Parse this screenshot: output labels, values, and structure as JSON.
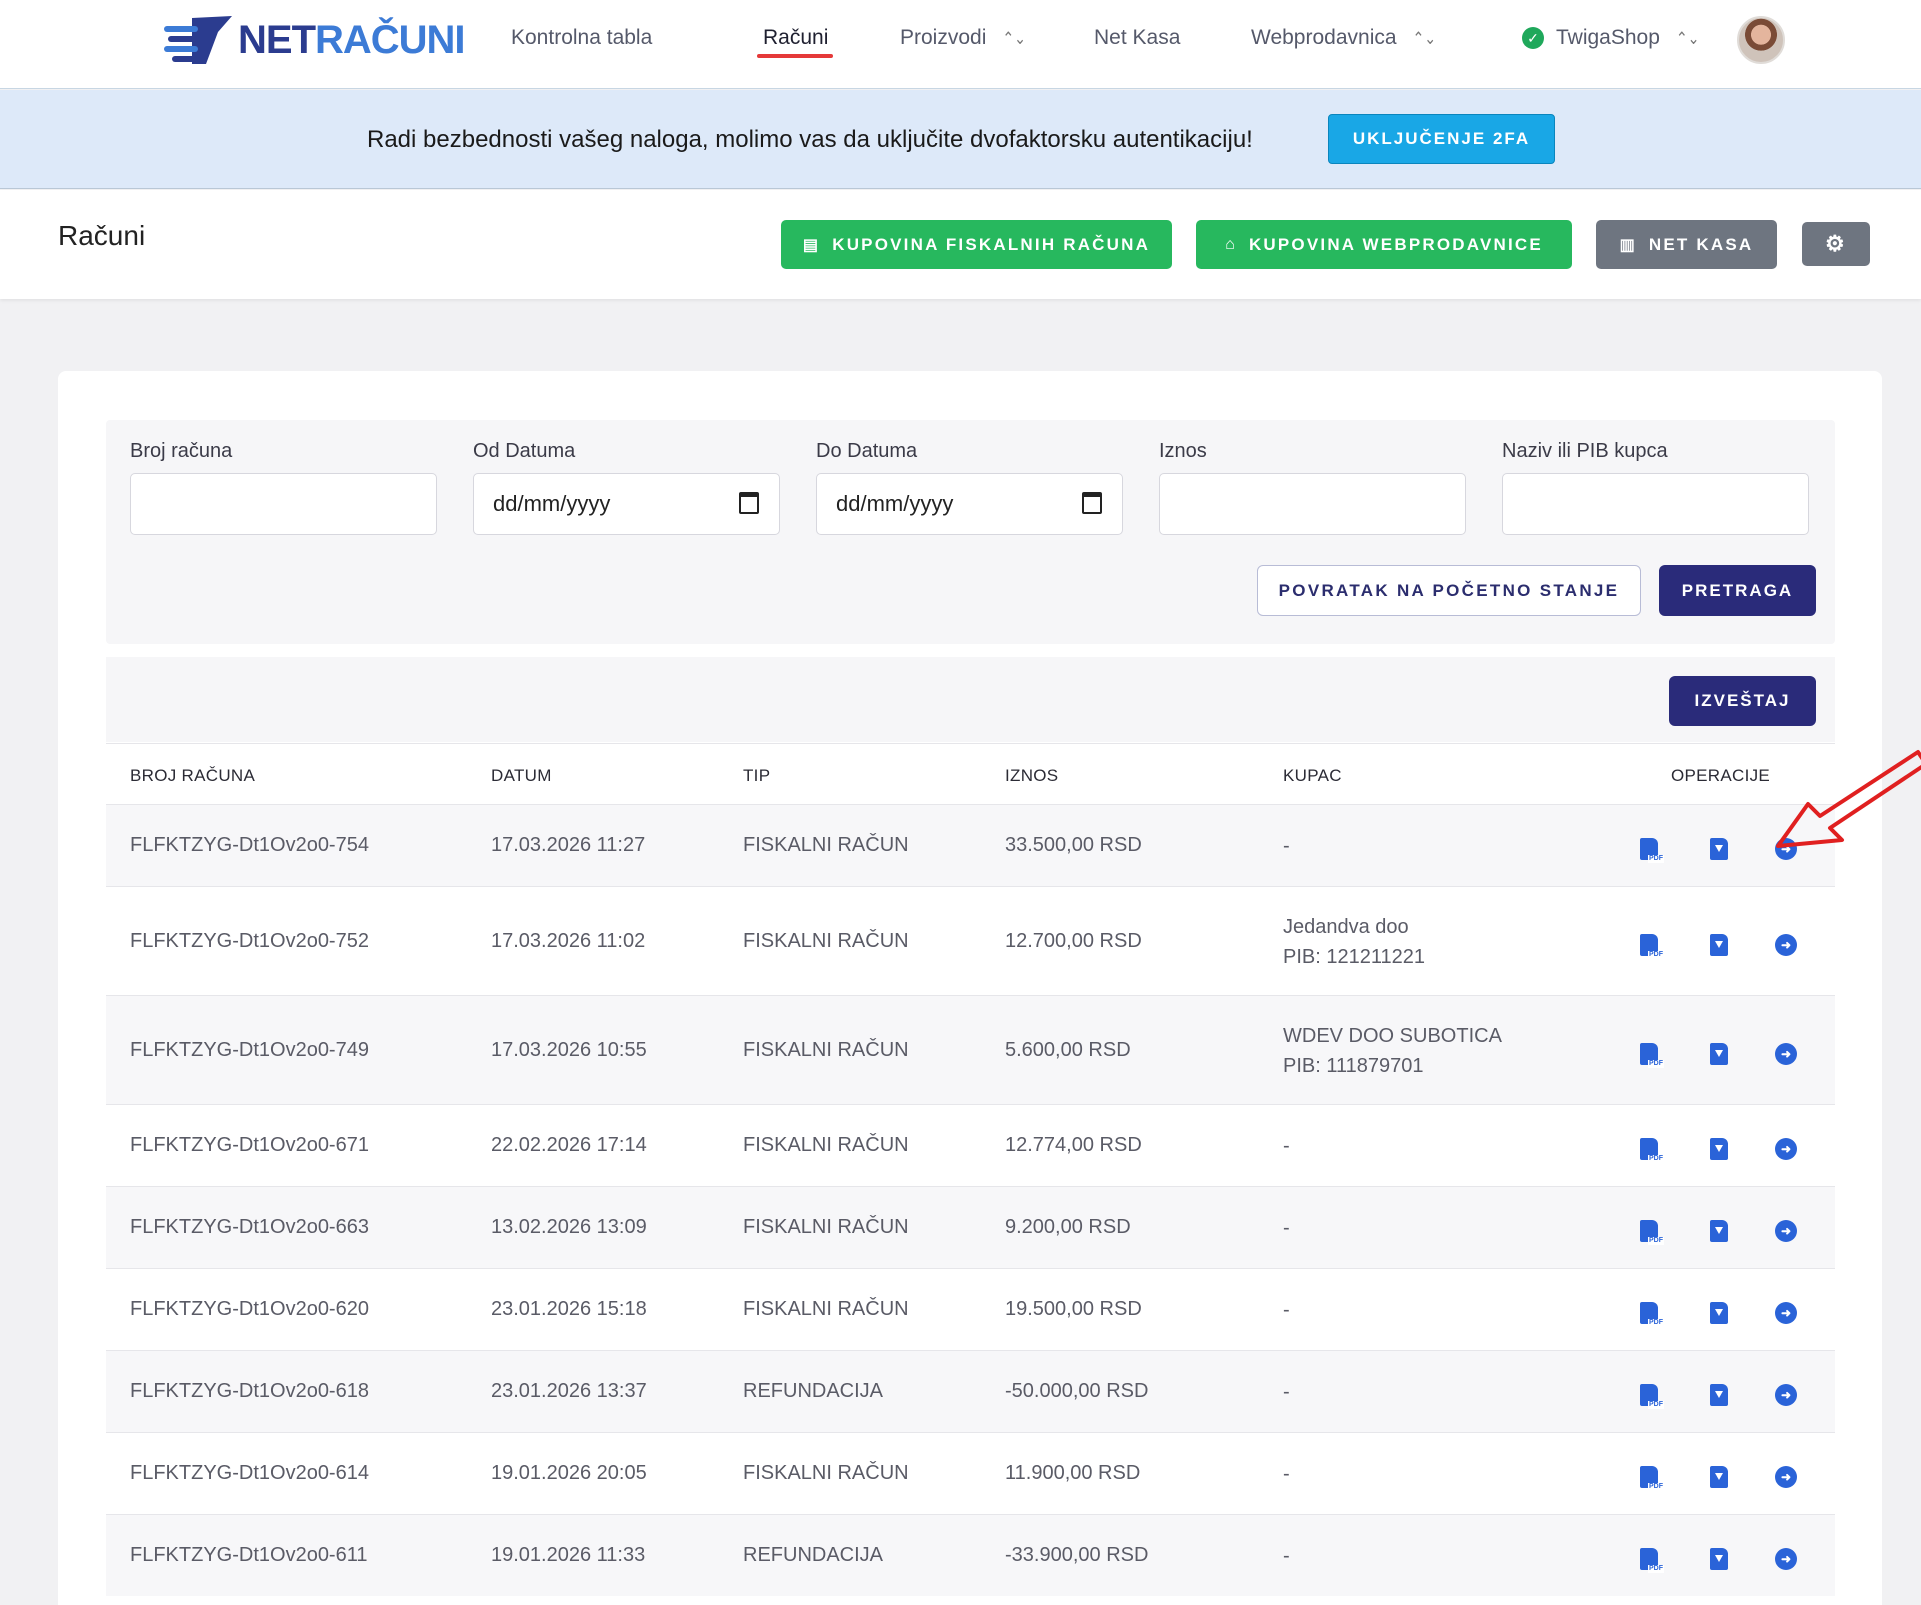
{
  "brand": {
    "name_part1": "NET",
    "name_part2": "RAČUNI"
  },
  "nav": {
    "items": [
      {
        "label": "Kontrolna tabla"
      },
      {
        "label": "Računi"
      },
      {
        "label": "Proizvodi"
      },
      {
        "label": "Net Kasa"
      },
      {
        "label": "Webprodavnica"
      }
    ],
    "shop": {
      "label": "TwigaShop"
    }
  },
  "banner": {
    "text": "Radi bezbednosti vašeg naloga, molimo vas da uključite dvofaktorsku autentikaciju!",
    "button": "UKLJUČENJE 2FA"
  },
  "header": {
    "title": "Računi",
    "buttons": {
      "fiscal": "KUPOVINA FISKALNIH RAČUNA",
      "webshop": "KUPOVINA WEBPRODAVNICE",
      "netkasa": "NET KASA"
    }
  },
  "filters": {
    "invoice_no": {
      "label": "Broj računa",
      "value": ""
    },
    "date_from": {
      "label": "Od Datuma",
      "value": "dd/mm/yyyy"
    },
    "date_to": {
      "label": "Do Datuma",
      "value": "dd/mm/yyyy"
    },
    "amount": {
      "label": "Iznos",
      "value": ""
    },
    "customer": {
      "label": "Naziv ili PIB kupca",
      "value": ""
    },
    "reset_button": "POVRATAK NA POČETNO STANJE",
    "search_button": "PRETRAGA"
  },
  "report_button": "IZVEŠTAJ",
  "table": {
    "columns": [
      "BROJ RAČUNA",
      "DATUM",
      "TIP",
      "IZNOS",
      "KUPAC",
      "OPERACIJE"
    ],
    "rows": [
      {
        "number": "FLFKTZYG-Dt1Ov2o0-754",
        "date": "17.03.2026 11:27",
        "type": "FISKALNI RAČUN",
        "amount": "33.500,00 RSD",
        "customer": "-",
        "pib": ""
      },
      {
        "number": "FLFKTZYG-Dt1Ov2o0-752",
        "date": "17.03.2026 11:02",
        "type": "FISKALNI RAČUN",
        "amount": "12.700,00 RSD",
        "customer": "Jedandva doo",
        "pib": "PIB: 121211221"
      },
      {
        "number": "FLFKTZYG-Dt1Ov2o0-749",
        "date": "17.03.2026 10:55",
        "type": "FISKALNI RAČUN",
        "amount": "5.600,00 RSD",
        "customer": "WDEV DOO SUBOTICA",
        "pib": "PIB: 111879701"
      },
      {
        "number": "FLFKTZYG-Dt1Ov2o0-671",
        "date": "22.02.2026 17:14",
        "type": "FISKALNI RAČUN",
        "amount": "12.774,00 RSD",
        "customer": "-",
        "pib": ""
      },
      {
        "number": "FLFKTZYG-Dt1Ov2o0-663",
        "date": "13.02.2026 13:09",
        "type": "FISKALNI RAČUN",
        "amount": "9.200,00 RSD",
        "customer": "-",
        "pib": ""
      },
      {
        "number": "FLFKTZYG-Dt1Ov2o0-620",
        "date": "23.01.2026 15:18",
        "type": "FISKALNI RAČUN",
        "amount": "19.500,00 RSD",
        "customer": "-",
        "pib": ""
      },
      {
        "number": "FLFKTZYG-Dt1Ov2o0-618",
        "date": "23.01.2026 13:37",
        "type": "REFUNDACIJA",
        "amount": "-50.000,00 RSD",
        "customer": "-",
        "pib": ""
      },
      {
        "number": "FLFKTZYG-Dt1Ov2o0-614",
        "date": "19.01.2026 20:05",
        "type": "FISKALNI RAČUN",
        "amount": "11.900,00 RSD",
        "customer": "-",
        "pib": ""
      },
      {
        "number": "FLFKTZYG-Dt1Ov2o0-611",
        "date": "19.01.2026 11:33",
        "type": "REFUNDACIJA",
        "amount": "-33.900,00 RSD",
        "customer": "-",
        "pib": ""
      }
    ]
  },
  "colors": {
    "brand_navy": "#2b3c8f",
    "accent_red": "#e53939",
    "success_green": "#27b85e",
    "primary_button": "#2a2b7a",
    "info_blue": "#19a7e6",
    "icon_blue": "#2a63d8"
  },
  "icons": {
    "brand": "netracuni-logo-icon",
    "shop_status": "check-circle-icon",
    "user": "avatar",
    "fiscal_button": "receipt-icon",
    "webshop_button": "store-icon",
    "netkasa_button": "cash-register-icon",
    "settings": "gear-icon",
    "calendar": "calendar-icon",
    "row_pdf": "file-pdf-icon",
    "row_download": "file-download-icon",
    "row_open": "arrow-circle-right-icon",
    "annotation": "red-arrow-icon"
  }
}
